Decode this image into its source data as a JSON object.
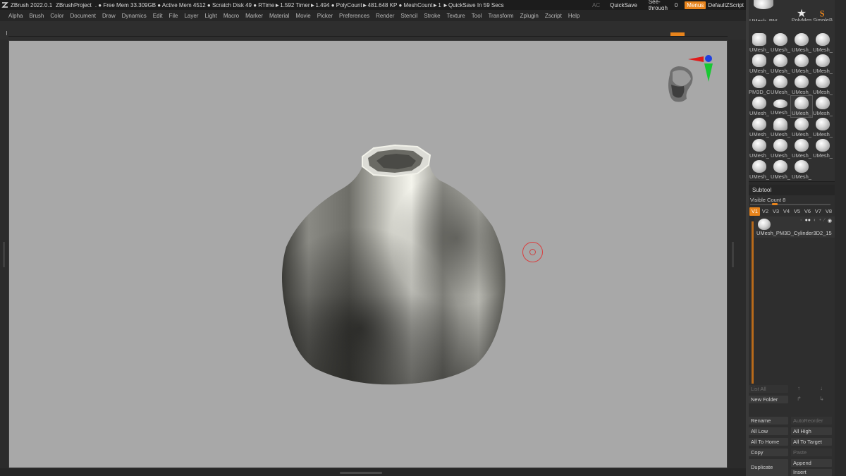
{
  "titlebar": {
    "app": "ZBrush 2022.0.1",
    "project": "ZBrushProject",
    "stats": ". ● Free Mem 33.309GB ● Active Mem 4512 ● Scratch Disk 49 ●  RTime►1.592 Timer►1.494 ● PolyCount►481.648 KP  ● MeshCount►1   ►QuickSave In 59 Secs",
    "ac": "AC",
    "quicksave": "QuickSave",
    "see_through": "See-through",
    "see_through_value": "0",
    "menus": "Menus",
    "default_zscript": "DefaultZScript"
  },
  "menubar": [
    "Alpha",
    "Brush",
    "Color",
    "Document",
    "Draw",
    "Dynamics",
    "Edit",
    "File",
    "Layer",
    "Light",
    "Macro",
    "Marker",
    "Material",
    "Movie",
    "Picker",
    "Preferences",
    "Render",
    "Stencil",
    "Stroke",
    "Texture",
    "Tool",
    "Transform",
    "Zplugin",
    "Zscript",
    "Help"
  ],
  "palette": {
    "row0": [
      "UMesh_PM3D_C",
      "PolyMes",
      "SimpleB"
    ],
    "labels": [
      [
        "UMesh_",
        "UMesh_",
        "UMesh_",
        "UMesh_"
      ],
      [
        "UMesh_",
        "UMesh_",
        "UMesh_",
        "UMesh_"
      ],
      [
        "PM3D_C",
        "UMesh_",
        "UMesh_",
        "UMesh_"
      ],
      [
        "UMesh_",
        "UMesh_",
        "UMesh_",
        "UMesh_"
      ],
      [
        "UMesh_",
        "UMesh_",
        "UMesh_",
        "UMesh_"
      ],
      [
        "UMesh_",
        "UMesh_",
        "UMesh_",
        "UMesh_"
      ],
      [
        "UMesh_",
        "UMesh_",
        "UMesh_"
      ]
    ]
  },
  "subtool": {
    "title": "Subtool",
    "visible_count": "Visible Count 8",
    "versions": [
      "V1",
      "V2",
      "V3",
      "V4",
      "V5",
      "V6",
      "V7",
      "V8"
    ],
    "active_version": "V1",
    "item_name": "UMesh_PM3D_Cylinder3D2_15",
    "list_all": "List All",
    "new_folder": "New Folder",
    "rename": "Rename",
    "auto_reorder": "AutoReorder",
    "all_low": "All Low",
    "all_high": "All High",
    "all_to_home": "All To Home",
    "all_to_target": "All To Target",
    "copy": "Copy",
    "paste": "Paste",
    "duplicate": "Duplicate",
    "append": "Append",
    "insert": "Insert"
  },
  "colors": {
    "accent": "#e8841c",
    "canvas": "#a8a8a8",
    "panel": "#2a2a2a"
  }
}
